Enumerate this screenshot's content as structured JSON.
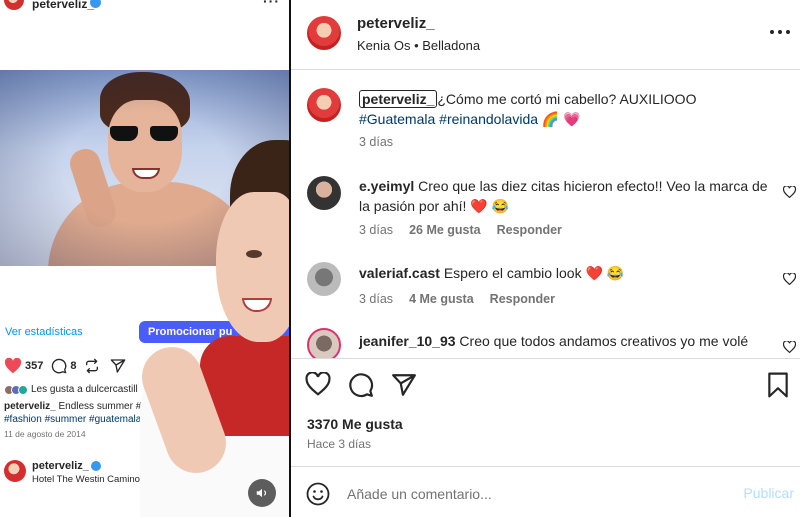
{
  "video": {
    "top_username": "peterveliz_",
    "stats_link": "Ver estadísticas",
    "promote_button": "Promocionar pu",
    "likes": "357",
    "comments": "8",
    "liked_by": "Les gusta a dulcercastill",
    "caption_user": "peterveliz_",
    "caption_text": "Endless summer #s",
    "caption_tags": "#fashion #summer #guatemala",
    "date": "11 de agosto de 2014",
    "location_user": "peterveliz_",
    "location_place": "Hotel The Westin Camino"
  },
  "post": {
    "username": "peterveliz_",
    "subtitle": "Kenia Os • Belladona",
    "caption": {
      "user": "peterveliz_",
      "text": "¿Cómo me cortó mi cabello? AUXILIOOO",
      "tag1": "#Guatemala",
      "tag2": "#reinandolavida",
      "emojis": "🌈 💗",
      "time": "3 días"
    },
    "comments": [
      {
        "user": "e.yeimyl",
        "text": "Creo que las diez citas hicieron efecto!! Veo la marca de la pasión por ahí!",
        "emojis": "❤️ 😂",
        "time": "3 días",
        "likes": "26 Me gusta",
        "reply": "Responder"
      },
      {
        "user": "valeriaf.cast",
        "text": "Espero el cambio look",
        "emojis": "❤️ 😂",
        "time": "3 días",
        "likes": "4 Me gusta",
        "reply": "Responder"
      },
      {
        "user": "jeanifer_10_93",
        "text": "Creo que todos andamos creativos yo me volé"
      }
    ],
    "likes_count": "3370 Me gusta",
    "post_time": "Hace 3 días",
    "comment_placeholder": "Añade un comentario...",
    "publish_label": "Publicar"
  },
  "colors": {
    "accent": "#0095f6",
    "promote": "#4a5df9",
    "like_red": "#ed4956",
    "publish_disabled": "#b2dffc",
    "hashtag": "#00376b"
  }
}
